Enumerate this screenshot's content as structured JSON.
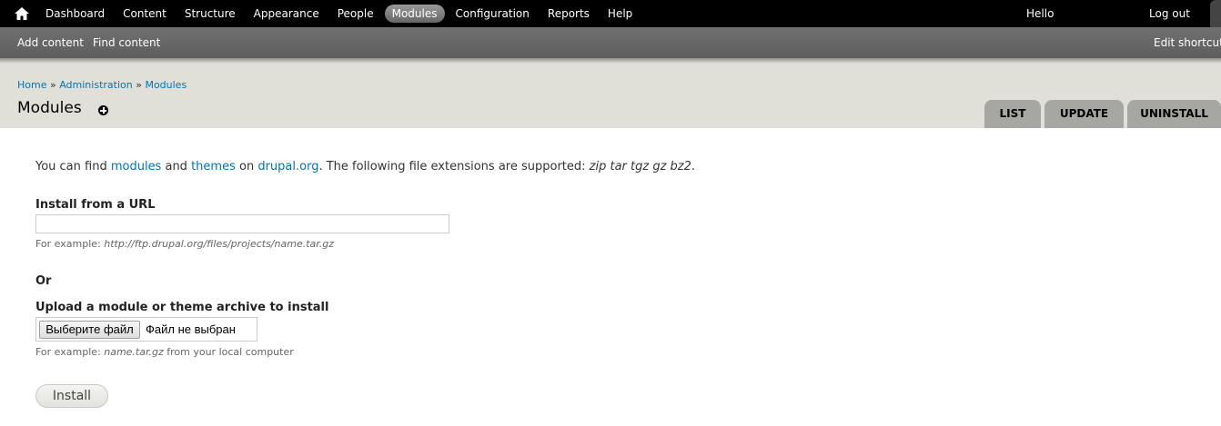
{
  "toolbar": {
    "menu": [
      {
        "label": "Dashboard"
      },
      {
        "label": "Content"
      },
      {
        "label": "Structure"
      },
      {
        "label": "Appearance"
      },
      {
        "label": "People"
      },
      {
        "label": "Modules"
      },
      {
        "label": "Configuration"
      },
      {
        "label": "Reports"
      },
      {
        "label": "Help"
      }
    ],
    "active_item": "Modules",
    "hello": "Hello",
    "logout": "Log out"
  },
  "shortcuts": {
    "add_content": "Add content",
    "find_content": "Find content",
    "edit_shortcuts": "Edit shortcuts"
  },
  "breadcrumb": {
    "home": "Home",
    "sep": "»",
    "administration": "Administration",
    "modules": "Modules"
  },
  "page": {
    "title": "Modules"
  },
  "tabs": {
    "list": "LIST",
    "update": "UPDATE",
    "uninstall": "UNINSTALL"
  },
  "intro": {
    "part1": "You can find ",
    "link_modules": "modules",
    "part2": " and ",
    "link_themes": "themes",
    "part3": " on ",
    "link_drupal": "drupal.org",
    "part4": ". The following file extensions are supported: ",
    "extensions": "zip tar tgz gz bz2",
    "part5": "."
  },
  "form": {
    "url_label": "Install from a URL",
    "url_value": "",
    "url_desc_prefix": "For example: ",
    "url_desc_example": "http://ftp.drupal.org/files/projects/name.tar.gz",
    "or_label": "Or",
    "upload_label": "Upload a module or theme archive to install",
    "file_button": "Выберите файл",
    "file_status": "Файл не выбран",
    "upload_desc_prefix": "For example: ",
    "upload_desc_example": "name.tar.gz",
    "upload_desc_suffix": " from your local computer",
    "install_button": "Install"
  },
  "colors": {
    "link": "#0074bd",
    "toolbar_bg": "#000000",
    "shortcuts_bg": "#666666",
    "header_bg": "#e0e0d8",
    "tab_bg": "#a6a7a2"
  },
  "icons": {
    "home": "home-icon",
    "add_shortcut": "add-shortcut-icon"
  }
}
